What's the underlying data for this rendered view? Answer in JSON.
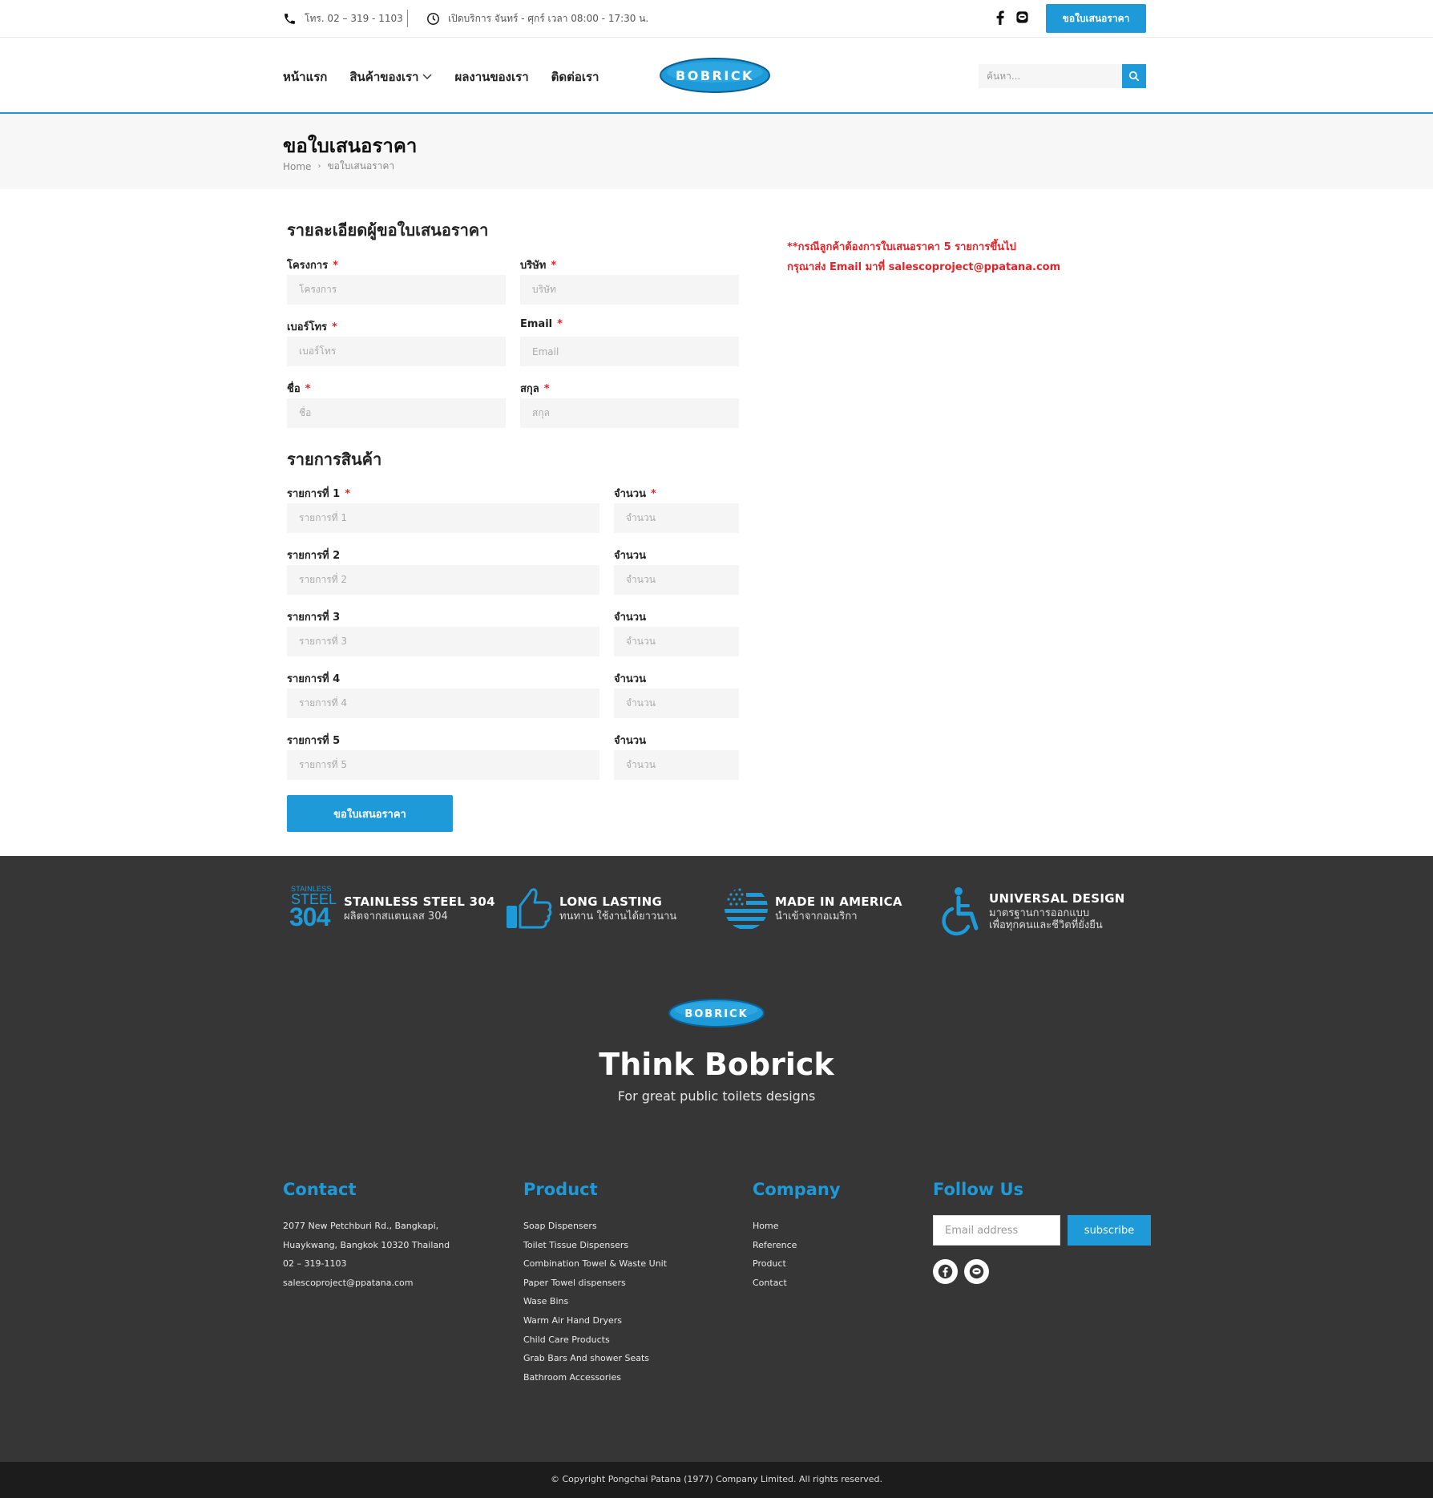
{
  "topbar": {
    "phone": "โทร. 02 – 319 - 1103",
    "hours": "เปิดบริการ จันทร์ - ศุกร์ เวลา 08:00 - 17:30 น.",
    "quote_button": "ขอใบเสนอราคา"
  },
  "header": {
    "nav": [
      "หน้าแรก",
      "สินค้าของเรา",
      "ผลงานของเรา",
      "ติดต่อเรา"
    ],
    "logo_text": "BOBRICK",
    "search_placeholder": "ค้นหา..."
  },
  "page": {
    "title": "ขอใบเสนอราคา",
    "breadcrumb": [
      "Home",
      "ขอใบเสนอราคา"
    ]
  },
  "form": {
    "details_title": "รายละเอียดผู้ขอใบเสนอราคา",
    "req_mark": "*",
    "fields": [
      {
        "label": "โครงการ",
        "placeholder": "โครงการ",
        "required": true
      },
      {
        "label": "บริษัท",
        "placeholder": "บริษัท",
        "required": true
      },
      {
        "label": "เบอร์โทร",
        "placeholder": "เบอร์โทร",
        "required": true
      },
      {
        "label": "Email",
        "placeholder": "Email",
        "required": true
      },
      {
        "label": "ชื่อ",
        "placeholder": "ชื่อ",
        "required": true
      },
      {
        "label": "สกุล",
        "placeholder": "สกุล",
        "required": true
      }
    ],
    "items_title": "รายการสินค้า",
    "items": [
      {
        "label": "รายการที่ 1",
        "placeholder": "รายการที่ 1",
        "qty_label": "จำนวน",
        "qty_placeholder": "จำนวน"
      },
      {
        "label": "รายการที่ 2",
        "placeholder": "รายการที่ 2",
        "qty_label": "จำนวน",
        "qty_placeholder": "จำนวน"
      },
      {
        "label": "รายการที่ 3",
        "placeholder": "รายการที่ 3",
        "qty_label": "จำนวน",
        "qty_placeholder": "จำนวน"
      },
      {
        "label": "รายการที่ 4",
        "placeholder": "รายการที่ 4",
        "qty_label": "จำนวน",
        "qty_placeholder": "จำนวน"
      },
      {
        "label": "รายการที่ 5",
        "placeholder": "รายการที่ 5",
        "qty_label": "จำนวน",
        "qty_placeholder": "จำนวน"
      }
    ],
    "submit": "ขอใบเสนอราคา"
  },
  "notice": {
    "line1": "**กรณีลูกค้าต้องการใบเสนอราคา 5 รายการขึ้นไป",
    "line2": "กรุณาส่ง Email มาที่ salescoproject@ppatana.com"
  },
  "features": [
    {
      "title": "STAINLESS STEEL 304",
      "subtitle": "ผลิตจากสแตนเลส 304",
      "icon": "stainless-steel-304-icon",
      "badge_small": "STAINLESS",
      "badge_mid": "STEEL",
      "badge_big": "304"
    },
    {
      "title": "LONG LASTING",
      "subtitle": "ทนทาน ใช้งานได้ยาวนาน",
      "icon": "thumbs-up-icon"
    },
    {
      "title": "MADE IN AMERICA",
      "subtitle": "นำเข้าจากอเมริกา",
      "icon": "us-flag-icon"
    },
    {
      "title": "UNIVERSAL DESIGN",
      "subtitle": "มาตรฐานการออกแบบ",
      "subtitle2": "เพื่อทุกคนและชีวิตที่ยั่งยืน",
      "icon": "wheelchair-icon"
    }
  ],
  "footer": {
    "logo_text": "BOBRICK",
    "heading": "Think Bobrick",
    "tagline": "For great public toilets designs",
    "contact": {
      "title": "Contact",
      "lines": [
        "2077 New Petchburi Rd., Bangkapi,",
        "Huaykwang, Bangkok 10320 Thailand",
        "02 – 319-1103",
        "salescoproject@ppatana.com"
      ]
    },
    "product": {
      "title": "Product",
      "links": [
        "Soap Dispensers",
        "Toilet Tissue Dispensers",
        "Combination Towel & Waste Unit",
        "Paper Towel dispensers",
        "Wase Bins",
        "Warm Air Hand Dryers",
        "Child Care Products",
        "Grab Bars And shower Seats",
        "Bathroom Accessories"
      ]
    },
    "company": {
      "title": "Company",
      "links": [
        "Home",
        "Reference",
        "Product",
        "Contact"
      ]
    },
    "follow": {
      "title": "Follow Us",
      "email_placeholder": "Email address",
      "subscribe": "subscribe"
    },
    "copyright": "© Copyright Pongchai Patana (1977) Company Limited. All rights reserved."
  },
  "colors": {
    "accent": "#1e9ad9",
    "required": "#e0252a",
    "footer_bg": "#363636",
    "copy_bg": "#1c1c1c"
  }
}
